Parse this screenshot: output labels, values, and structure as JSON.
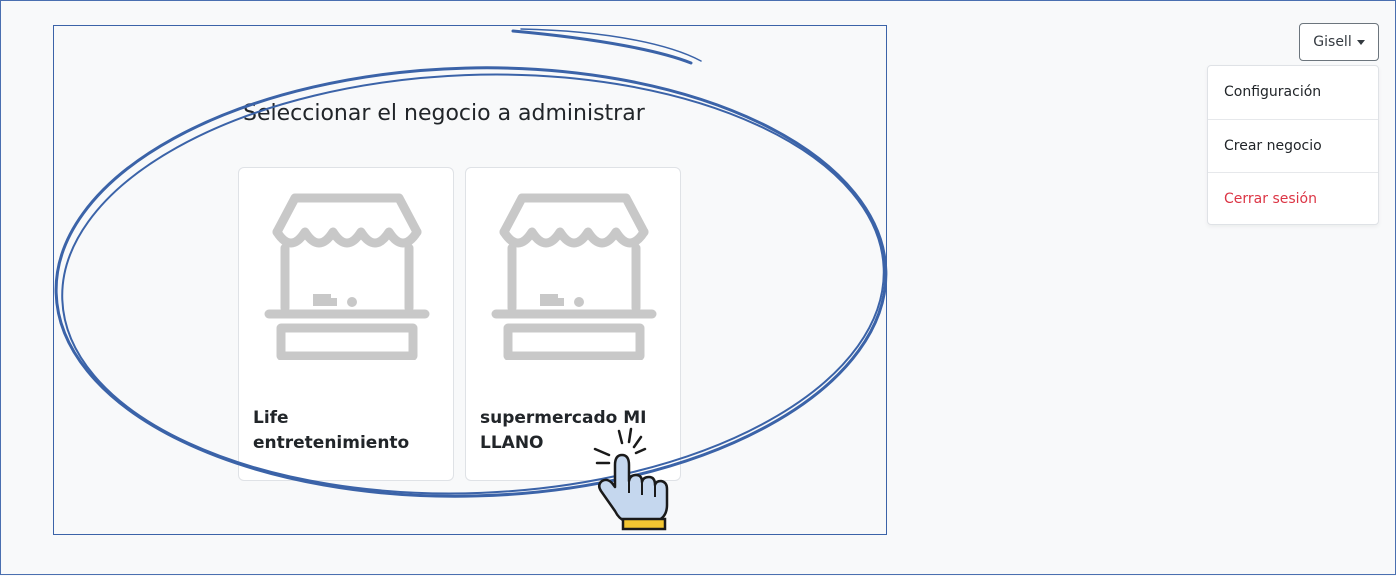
{
  "heading": "Seleccionar el negocio a administrar",
  "businesses": [
    {
      "name": "Life entretenimiento",
      "icon": "store-icon"
    },
    {
      "name": "supermercado MI LLANO",
      "icon": "store-icon"
    }
  ],
  "user_menu": {
    "button_label": "Gisell",
    "items": [
      {
        "label": "Configuración"
      },
      {
        "label": "Crear negocio"
      },
      {
        "label": "Cerrar sesión"
      }
    ]
  },
  "colors": {
    "annotation": "#3b63a8",
    "icon_gray": "#c8c8c8",
    "logout_red": "#dc3545",
    "hand_fill": "#c5d7ee",
    "hand_cuff": "#f2c531"
  }
}
